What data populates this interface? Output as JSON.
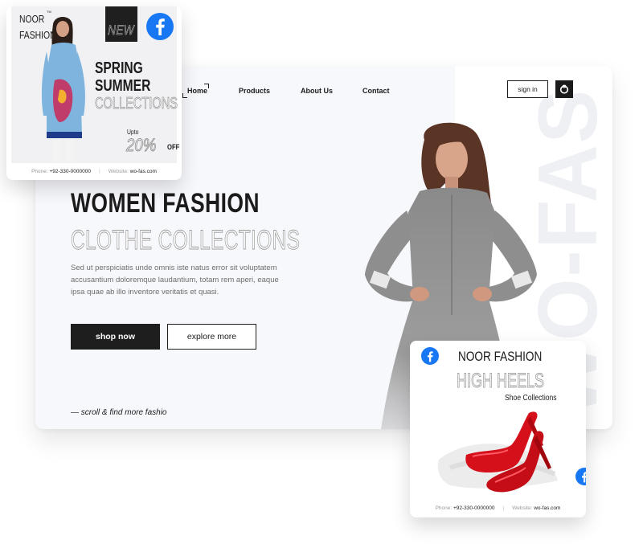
{
  "nav": {
    "links": [
      "Home",
      "Products",
      "About Us",
      "Contact"
    ],
    "signin_label": "sign in",
    "bag_icon": "bag-icon"
  },
  "hero": {
    "watermark": "WO-FAS",
    "title": "WOMEN FASHION",
    "subtitle": "CLOTHE COLLECTIONS",
    "description": "Sed ut perspiciatis unde omnis iste natus error sit voluptatem accusantium doloremque laudantium, totam rem aperi, eaque ipsa quae ab illo inventore veritatis et quasi.",
    "primary_button": "shop now",
    "secondary_button": "explore more",
    "scroll_hint": "— scroll  & find more fashio"
  },
  "spring_post": {
    "brand": "NOOR\nFASHION",
    "tm": "TM",
    "badge": "NEW",
    "headline_line1": "SPRING",
    "headline_line2": "SUMMER",
    "headline_line3": "COLLECTIONS",
    "upto": "Upto",
    "percent": "20%",
    "off": "OFF",
    "phone_label": "Phone:",
    "phone": "+92-330-0000000",
    "website_label": "Website:",
    "website": "wo-fas.com",
    "separator": "|",
    "social_icon": "facebook-icon"
  },
  "heels_post": {
    "brand": "NOOR FASHION",
    "title": "HIGH HEELS",
    "subtitle": "Shoe Collections",
    "phone_label": "Phone:",
    "phone": "+92-330-0000000",
    "website_label": "Website:",
    "website": "wo-fas.com",
    "separator": "|",
    "social_icon": "facebook-icon"
  },
  "colors": {
    "text_dark": "#1b1b1b",
    "facebook_blue": "#1877f2",
    "heel_red": "#d5101b",
    "card_bg": "#f7f8fc"
  }
}
